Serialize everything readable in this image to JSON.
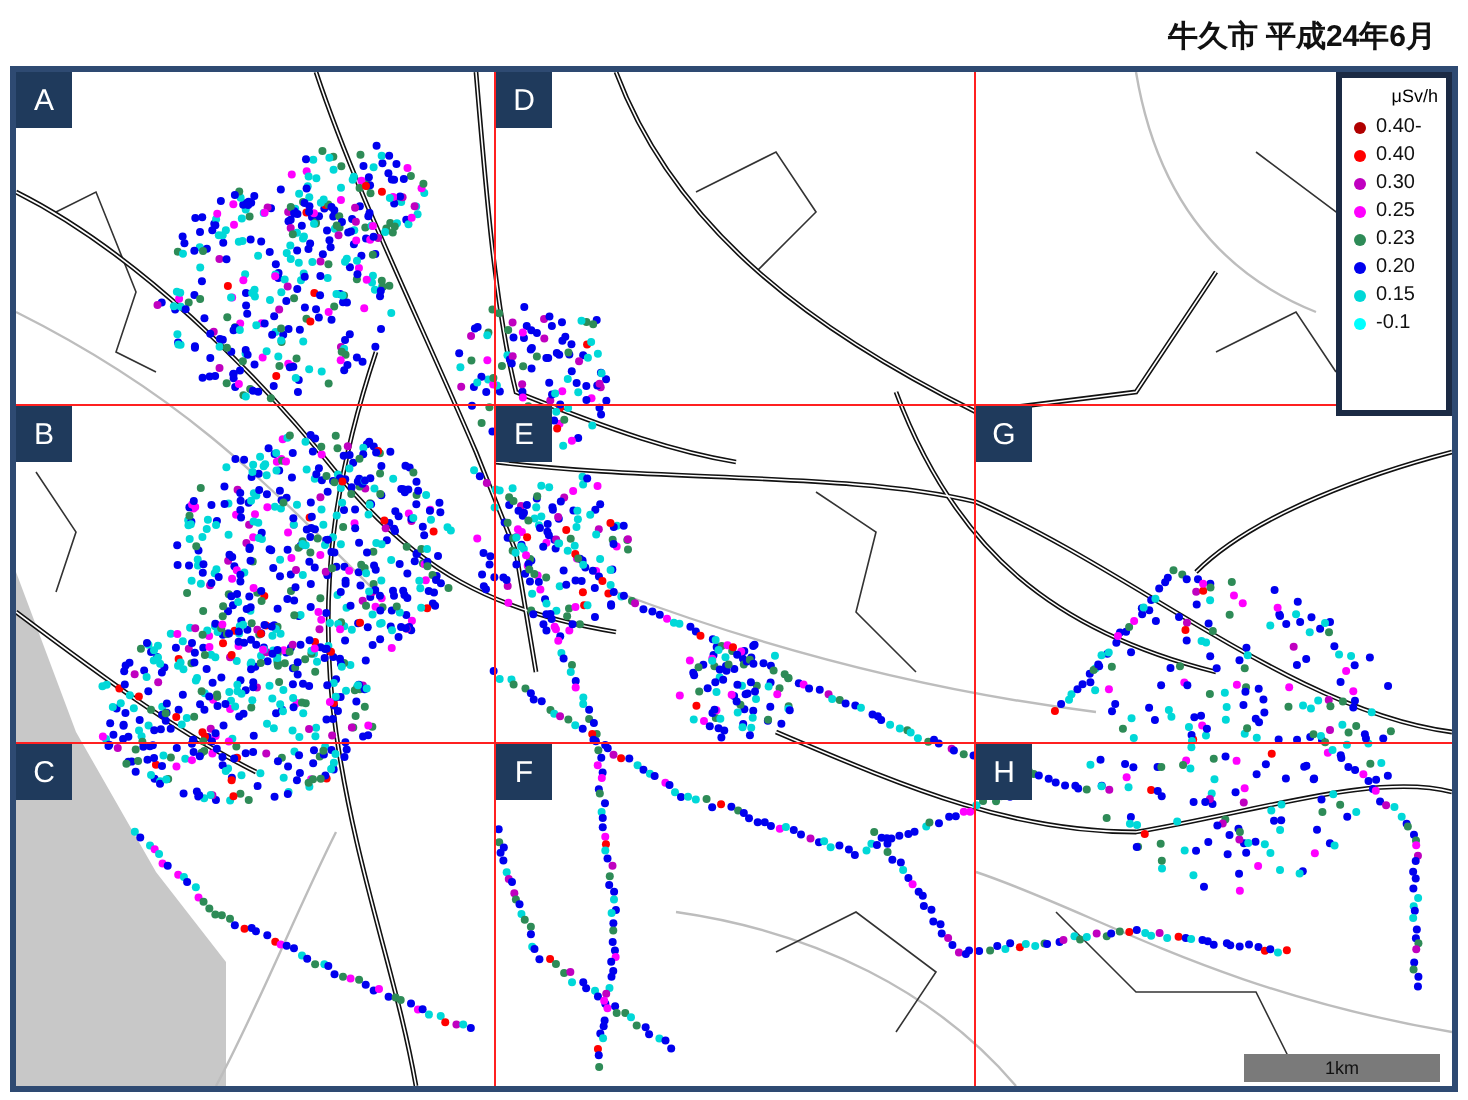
{
  "title": "牛久市 平成24年6月",
  "grid": {
    "rows": [
      [
        "A",
        "D",
        ""
      ],
      [
        "B",
        "E",
        "G"
      ],
      [
        "C",
        "F",
        "H"
      ]
    ]
  },
  "legend": {
    "unit": "μSv/h",
    "items": [
      {
        "label": "0.40-",
        "color": "#b00000"
      },
      {
        "label": "0.40",
        "color": "#ff0000"
      },
      {
        "label": "0.30",
        "color": "#c000c0"
      },
      {
        "label": "0.25",
        "color": "#ff00ff"
      },
      {
        "label": "0.23",
        "color": "#2e8b57"
      },
      {
        "label": "0.20",
        "color": "#0000ee"
      },
      {
        "label": "0.15",
        "color": "#00d8d8"
      },
      {
        "label": "-0.1",
        "color": "#00ffff"
      }
    ]
  },
  "scale_bar": {
    "label": "1km"
  }
}
